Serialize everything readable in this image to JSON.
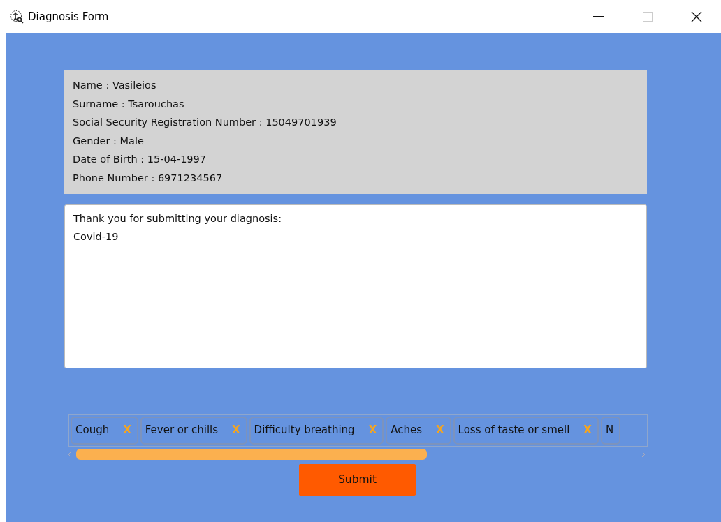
{
  "window": {
    "title": "Diagnosis Form"
  },
  "patient_info": [
    "Name : Vasileios",
    "Surname : Tsarouchas",
    "Social Security Registration Number : 15049701939",
    "Gender : Male",
    "Date of Birth : 15-04-1997",
    "Phone Number : 6971234567"
  ],
  "message_box": {
    "value": "Thank you for submitting your diagnosis:\nCovid-19"
  },
  "symptoms": [
    {
      "label": "Cough",
      "remove": "X"
    },
    {
      "label": "Fever or chills",
      "remove": "X"
    },
    {
      "label": "Difficulty breathing",
      "remove": "X"
    },
    {
      "label": "Aches",
      "remove": "X"
    },
    {
      "label": "Loss of taste or smell",
      "remove": "X"
    },
    {
      "label": "N"
    }
  ],
  "buttons": [
    {
      "label": "Submit"
    }
  ]
}
